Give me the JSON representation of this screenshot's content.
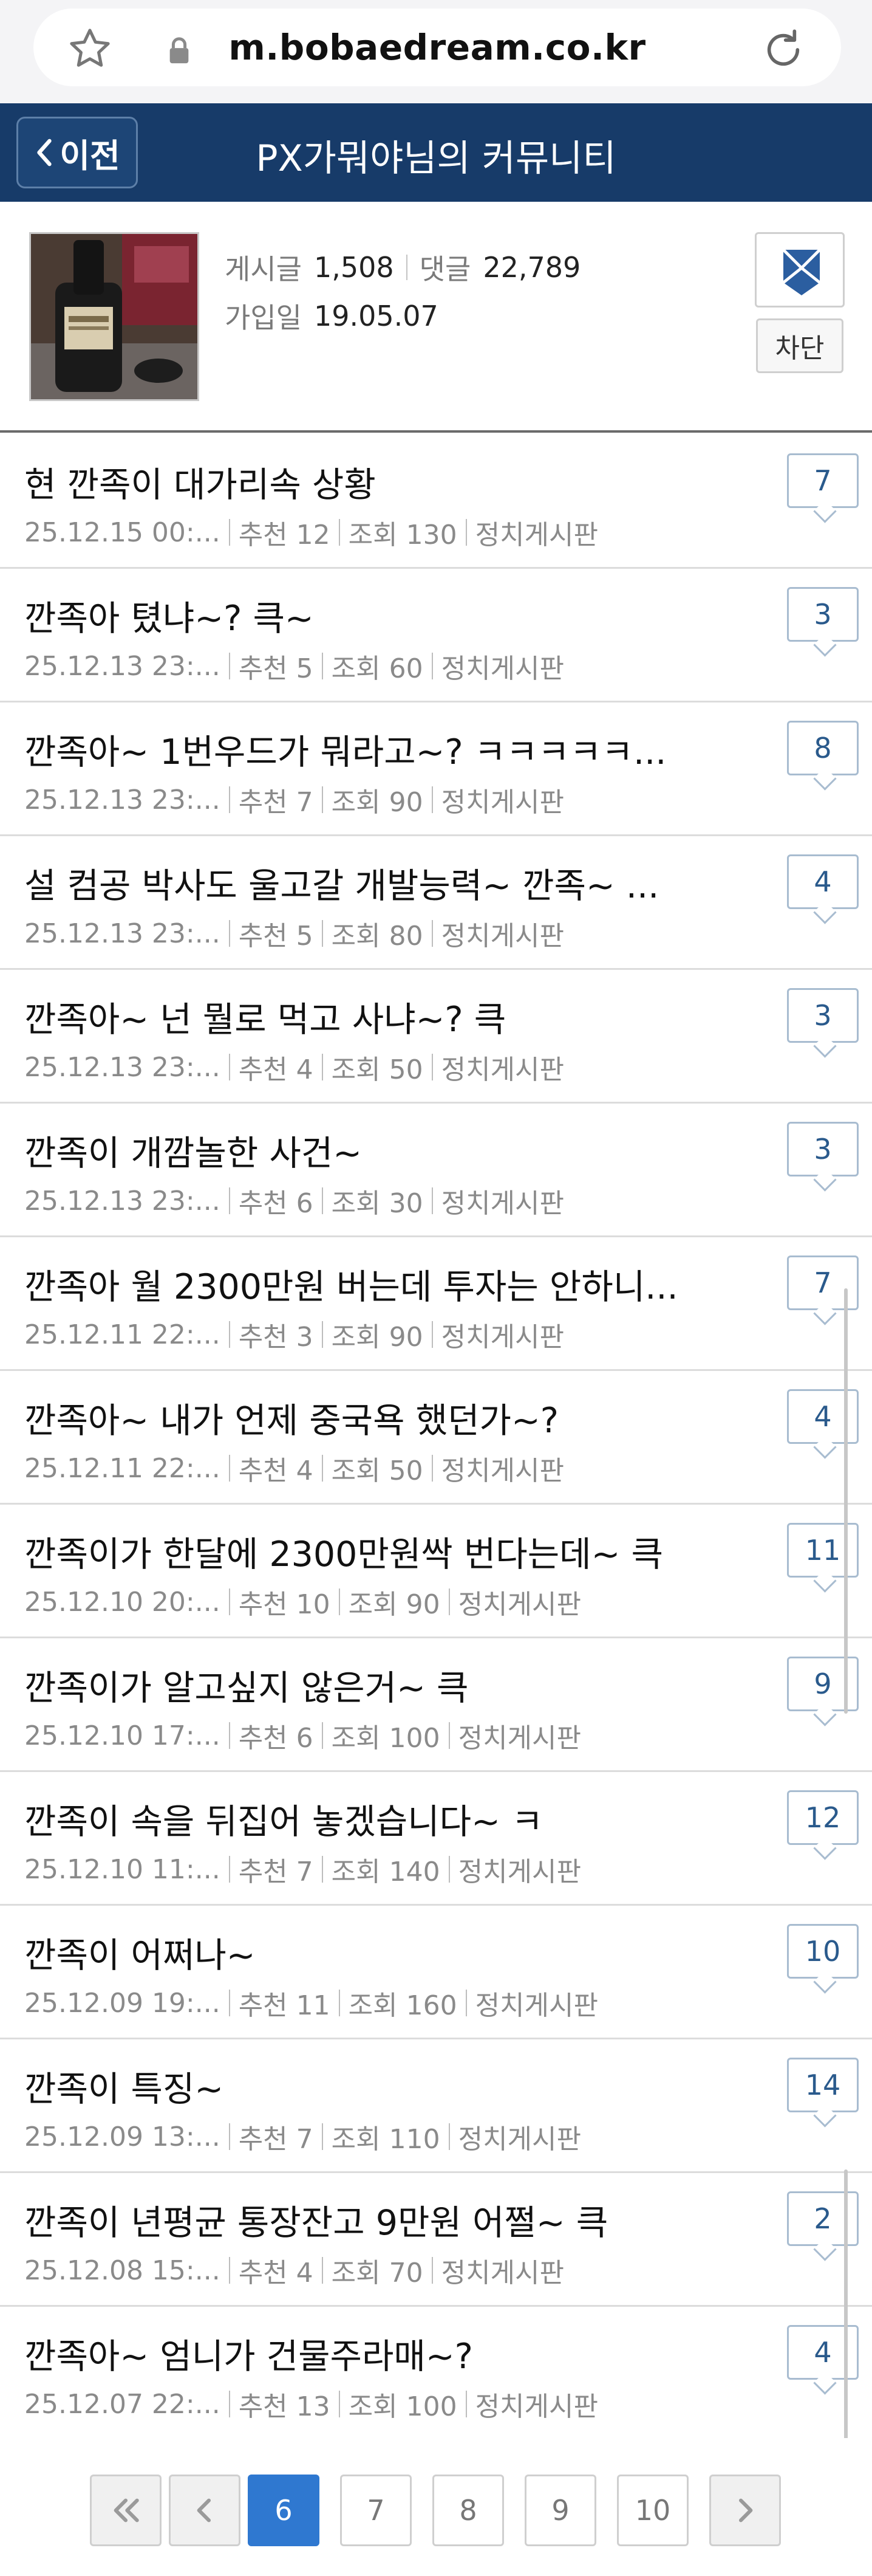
{
  "browser": {
    "url": "m.bobaedream.co.kr"
  },
  "header": {
    "back_label": "이전",
    "title": "PX가뭐야님의 커뮤니티"
  },
  "profile": {
    "posts_label": "게시글",
    "posts_value": "1,508",
    "comments_label": "댓글",
    "comments_value": "22,789",
    "joined_label": "가입일",
    "joined_value": "19.05.07",
    "block_label": "차단"
  },
  "posts": [
    {
      "title": "현 깐족이 대가리속 상황",
      "date": "25.12.15  00:...",
      "recommend": "추천 12",
      "views": "조회 130",
      "board": "정치게시판",
      "comments": "7"
    },
    {
      "title": "깐족아 텼냐~? 큭~",
      "date": "25.12.13  23:...",
      "recommend": "추천 5",
      "views": "조회 60",
      "board": "정치게시판",
      "comments": "3"
    },
    {
      "title": "깐족아~ 1번우드가 뭐라고~? ㅋㅋㅋㅋㅋ...",
      "date": "25.12.13  23:...",
      "recommend": "추천 7",
      "views": "조회 90",
      "board": "정치게시판",
      "comments": "8"
    },
    {
      "title": "설 컴공 박사도 울고갈 개발능력~ 깐족~ ...",
      "date": "25.12.13  23:...",
      "recommend": "추천 5",
      "views": "조회 80",
      "board": "정치게시판",
      "comments": "4"
    },
    {
      "title": "깐족아~ 넌 뭘로 먹고 사냐~? 큭",
      "date": "25.12.13  23:...",
      "recommend": "추천 4",
      "views": "조회 50",
      "board": "정치게시판",
      "comments": "3"
    },
    {
      "title": "깐족이 개깜놀한 사건~",
      "date": "25.12.13  23:...",
      "recommend": "추천 6",
      "views": "조회 30",
      "board": "정치게시판",
      "comments": "3"
    },
    {
      "title": "깐족아 월 2300만원 버는데 투자는 안하니...",
      "date": "25.12.11  22:...",
      "recommend": "추천 3",
      "views": "조회 90",
      "board": "정치게시판",
      "comments": "7"
    },
    {
      "title": "깐족아~ 내가 언제 중국욕 했던가~?",
      "date": "25.12.11  22:...",
      "recommend": "추천 4",
      "views": "조회 50",
      "board": "정치게시판",
      "comments": "4"
    },
    {
      "title": "깐족이가 한달에 2300만원싹 번다는데~ 큭",
      "date": "25.12.10  20:...",
      "recommend": "추천 10",
      "views": "조회 90",
      "board": "정치게시판",
      "comments": "11"
    },
    {
      "title": "깐족이가 알고싶지 않은거~ 큭",
      "date": "25.12.10  17:...",
      "recommend": "추천 6",
      "views": "조회 100",
      "board": "정치게시판",
      "comments": "9"
    },
    {
      "title": "깐족이 속을 뒤집어 놓겠습니다~ ㅋ",
      "date": "25.12.10  11:...",
      "recommend": "추천 7",
      "views": "조회 140",
      "board": "정치게시판",
      "comments": "12"
    },
    {
      "title": "깐족이 어쩌나~",
      "date": "25.12.09  19:...",
      "recommend": "추천 11",
      "views": "조회 160",
      "board": "정치게시판",
      "comments": "10"
    },
    {
      "title": "깐족이 특징~",
      "date": "25.12.09  13:...",
      "recommend": "추천 7",
      "views": "조회 110",
      "board": "정치게시판",
      "comments": "14"
    },
    {
      "title": "깐족이 년평균 통장잔고 9만원 어쩔~ 큭",
      "date": "25.12.08  15:...",
      "recommend": "추천 4",
      "views": "조회 70",
      "board": "정치게시판",
      "comments": "2"
    },
    {
      "title": "깐족아~ 엄니가 건물주라매~?",
      "date": "25.12.07  22:...",
      "recommend": "추천 13",
      "views": "조회 100",
      "board": "정치게시판",
      "comments": "4"
    }
  ],
  "pagination": {
    "pages": [
      "6",
      "7",
      "8",
      "9",
      "10"
    ],
    "current": "6"
  },
  "colors": {
    "header_bg": "#173b69",
    "active_page": "#2f78d0",
    "comment_count": "#2a5a8c"
  }
}
